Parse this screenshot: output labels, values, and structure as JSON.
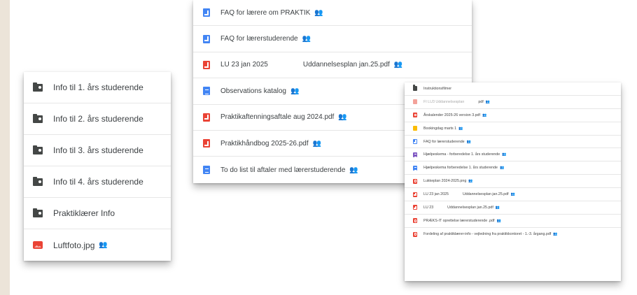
{
  "left_panel": {
    "items": [
      {
        "label": "Info til 1. års studerende",
        "icon": "folder-shared-icon",
        "shared": false
      },
      {
        "label": "Info til 2. års studerende",
        "icon": "folder-shared-icon",
        "shared": false
      },
      {
        "label": "Info til 3. års studerende",
        "icon": "folder-shared-icon",
        "shared": false
      },
      {
        "label": "Info til 4. års studerende",
        "icon": "folder-shared-icon",
        "shared": false
      },
      {
        "label": "Praktiklærer Info",
        "icon": "folder-shared-icon",
        "shared": false
      },
      {
        "label": "Luftfoto.jpg",
        "icon": "image-icon",
        "shared": true
      }
    ]
  },
  "middle_panel": {
    "items": [
      {
        "label": "FAQ for lærere om PRAKTIK",
        "icon": "slides-shortcut-icon",
        "shared": true,
        "extra": ""
      },
      {
        "label": "FAQ for lærerstuderende",
        "icon": "slides-shortcut-icon",
        "shared": true,
        "extra": ""
      },
      {
        "label": "LU 23 jan 2025",
        "icon": "pdf-shortcut-icon",
        "shared": false,
        "extra": "Uddannelsesplan jan.25.pdf"
      },
      {
        "label": "Observations katalog",
        "icon": "doc-icon",
        "shared": true,
        "extra": ""
      },
      {
        "label": "Praktikaftenningsaftale aug 2024.pdf",
        "icon": "pdf-shortcut-icon",
        "shared": true,
        "extra": ""
      },
      {
        "label": "Praktikhåndbog 2025-26.pdf",
        "icon": "pdf-shortcut-icon",
        "shared": true,
        "extra": ""
      },
      {
        "label": "To do list til aftaler med lærerstuderende",
        "icon": "doc-icon",
        "shared": true,
        "extra": ""
      }
    ]
  },
  "right_panel": {
    "items": [
      {
        "label": "Instruktionsfilmer",
        "icon": "folder-shared-icon",
        "shared": false,
        "extra": ""
      },
      {
        "label": "FI LU3 Uddannelsesplan",
        "icon": "pdf-shortcut-faint-icon",
        "shared": true,
        "extra": "pdf"
      },
      {
        "label": "Årskalender 2025-26 version 3.pdf",
        "icon": "pdf-icon",
        "shared": true,
        "extra": ""
      },
      {
        "label": "Bookingdag marts 1",
        "icon": "sheet-icon",
        "shared": true,
        "extra": ""
      },
      {
        "label": "FAQ for lærerstuderende",
        "icon": "slides-shortcut-icon",
        "shared": true,
        "extra": ""
      },
      {
        "label": "Hjælpeskema - forberedelse 1. års studerende",
        "icon": "form-icon",
        "shared": true,
        "extra": ""
      },
      {
        "label": "Hjælpeskema forberedelse 1. års studerende",
        "icon": "doc-icon",
        "shared": true,
        "extra": ""
      },
      {
        "label": "Lukkeplan 2024-2025.png",
        "icon": "pdf-icon",
        "shared": true,
        "extra": ""
      },
      {
        "label": "LU 23 jan 2025",
        "icon": "pdf-shortcut-icon",
        "shared": false,
        "extra": "Uddannelsesplan jan.25.pdf"
      },
      {
        "label": "LU 23",
        "icon": "pdf-shortcut-icon",
        "shared": false,
        "extra": "Uddannelsesplan jan.25.pdf"
      },
      {
        "label": "PRÆKS-IT oprettelse lærerstuderende .pdf",
        "icon": "pdf-icon",
        "shared": true,
        "extra": ""
      },
      {
        "label": "Fordeling af praktiklærer-info - vejledning fra praktikkontoret - 1.-3. årgang.pdf",
        "icon": "pdf-icon",
        "shared": true,
        "extra": ""
      }
    ]
  },
  "shared_glyph": "👥"
}
